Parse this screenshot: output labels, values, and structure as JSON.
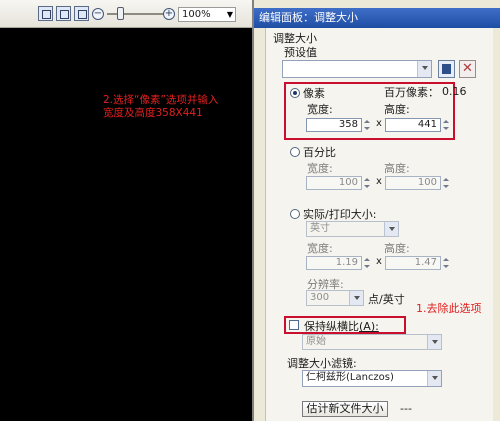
{
  "toolbar": {
    "zoom_minus": "−",
    "zoom_plus": "+",
    "zoom_value": "100%"
  },
  "annotations": {
    "step2_line1": "2.选择“像素”选项并输入",
    "step2_line2": "宽度及高度358X441",
    "step1": "1.去除此选项"
  },
  "panel": {
    "title": "编辑面板：调整大小",
    "section": "调整大小",
    "preset_label": "预设值",
    "preset_value": "",
    "pixels": {
      "label": "像素",
      "megapixels_label": "百万像素：",
      "megapixels_value": "0.16",
      "width_label": "宽度:",
      "height_label": "高度:",
      "width": "358",
      "height": "441",
      "times": "x"
    },
    "percent": {
      "label": "百分比",
      "width_label": "宽度:",
      "height_label": "高度:",
      "width": "100",
      "height": "100",
      "times": "x"
    },
    "print": {
      "label": "实际/打印大小:",
      "unit": "英寸",
      "width_label": "宽度:",
      "height_label": "高度:",
      "width": "1.19",
      "height": "1.47",
      "times": "x",
      "resolution_label": "分辨率:",
      "resolution_value": "300",
      "resolution_unit": "点/英寸"
    },
    "keep_aspect_label": "保持纵横比",
    "keep_aspect_key": "(A):",
    "aspect_mode": "原始",
    "filter_label": "调整大小滤镜:",
    "filter_value": "仁柯兹形(Lanczos)",
    "estimate_button": "估计新文件大小",
    "estimate_value": "---"
  },
  "colors": {
    "annotation": "#e02020",
    "highlight_box": "#c8102e",
    "title_bar": "#2a58b2"
  }
}
